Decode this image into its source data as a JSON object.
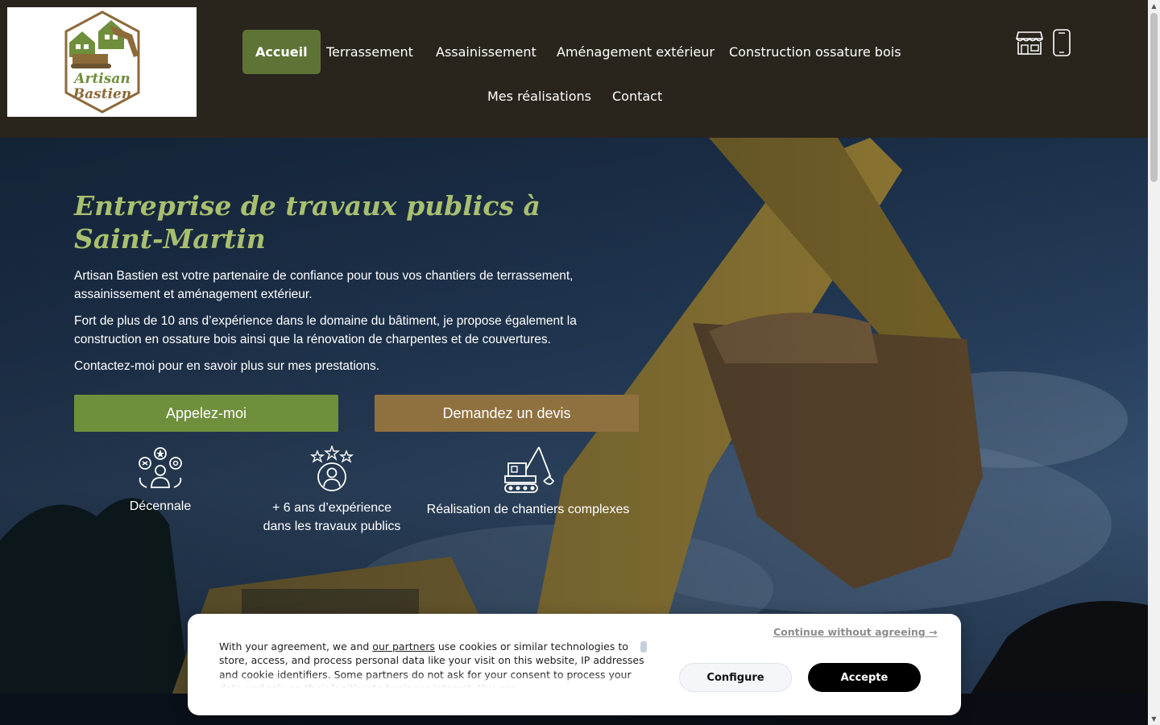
{
  "header": {
    "logo": {
      "line1": "Artisan",
      "line2": "Bastien"
    },
    "nav": [
      {
        "label": "Accueil",
        "active": true
      },
      {
        "label": "Terrassement"
      },
      {
        "label": "Assainissement"
      },
      {
        "label": "Aménagement extérieur"
      },
      {
        "label": "Construction ossature bois"
      },
      {
        "label": "Mes réalisations"
      },
      {
        "label": "Contact"
      }
    ],
    "icons": [
      "storefront-icon",
      "mobile-phone-icon"
    ]
  },
  "hero": {
    "title": "Entreprise de travaux publics à Saint-Martin",
    "paragraphs": [
      "Artisan Bastien est votre partenaire de confiance pour tous vos chantiers de terrassement, assainissement et aménagement extérieur.",
      "Fort de plus de 10 ans d’expérience dans le domaine du bâtiment, je propose également la construction en ossature bois ainsi que la rénovation de charpentes et de couvertures.",
      "Contactez-moi pour en savoir plus sur mes prestations."
    ],
    "buttons": {
      "call": "Appelez-moi",
      "quote": "Demandez un devis"
    },
    "features": [
      {
        "icon": "team-gear-icon",
        "label": "Décennale"
      },
      {
        "icon": "star-person-icon",
        "label": "+ 6 ans d’expérience dans les travaux publics"
      },
      {
        "icon": "excavator-icon",
        "label": "Réalisation de chantiers complexes"
      }
    ]
  },
  "cookie": {
    "text_before": "With your agreement, we and ",
    "link": "our partners",
    "text_after": " use cookies or similar technologies to store, access, and process personal data like your visit on this website, IP addresses and cookie identifiers. Some partners do not ask for your consent to process your data and rely on their legitimate business interest. You can",
    "continue": "Continue without agreeing →",
    "configure": "Configure",
    "accept": "Accepte"
  },
  "colors": {
    "header_bg": "#29251d",
    "accent_green": "#6f8f3c",
    "accent_brown": "#8f7140",
    "title_green": "#a9bf70"
  }
}
